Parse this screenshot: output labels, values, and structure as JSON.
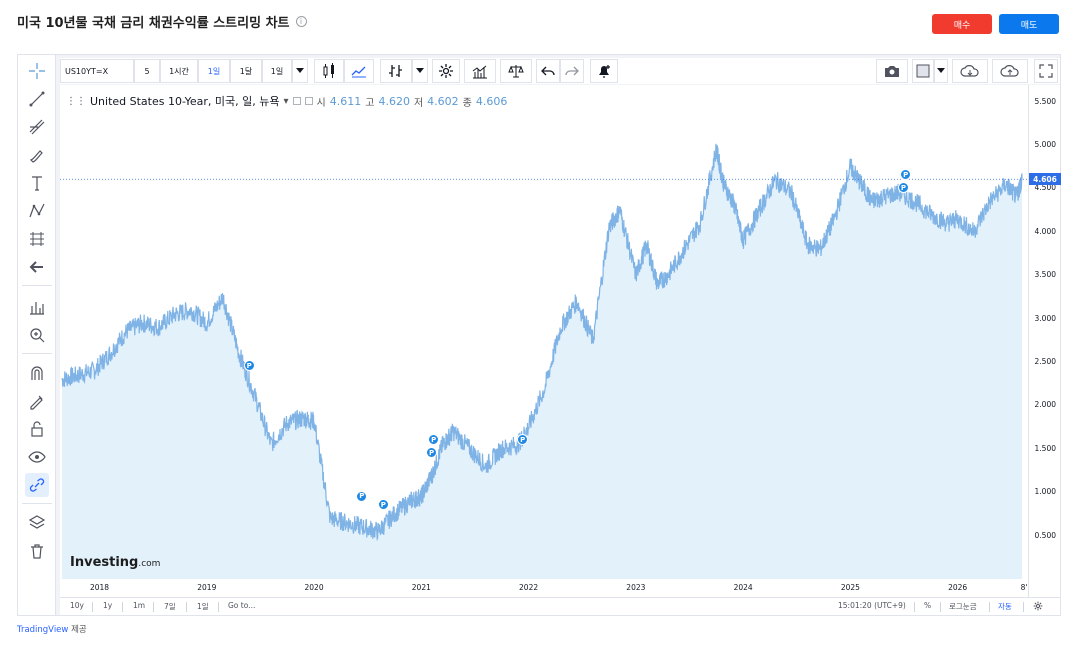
{
  "page": {
    "title": "미국 10년물 국채 금리 채권수익률 스트리밍 차트",
    "buy_label": "매수",
    "sell_label": "매도",
    "footer_link": "TradingView",
    "footer_text": "제공"
  },
  "toolbar": {
    "symbol": "US10YT=X",
    "intervals": [
      "5",
      "1시간",
      "1일",
      "1달",
      "1일"
    ],
    "active_interval_index": 2
  },
  "legend": {
    "name": "United States 10-Year, 미국, 일, 뉴욕",
    "open_label": "시",
    "open": "4.611",
    "high_label": "고",
    "high": "4.620",
    "low_label": "저",
    "low": "4.602",
    "close_label": "종",
    "close": "4.606"
  },
  "price_axis": {
    "labels": [
      "5.500",
      "5.000",
      "4.500",
      "4.000",
      "3.500",
      "3.000",
      "2.500",
      "2.000",
      "1.500",
      "1.000",
      "0.500"
    ],
    "current": "4.606"
  },
  "time_axis": {
    "labels": [
      "2018",
      "2019",
      "2020",
      "2021",
      "2022",
      "2023",
      "2024",
      "2025",
      "2026",
      "8'"
    ]
  },
  "bottom_bar": {
    "ranges": [
      "10y",
      "1y",
      "1m",
      "7일",
      "1일"
    ],
    "goto": "Go to...",
    "time": "15:01:20 (UTC+9)",
    "percent": "%",
    "log": "로그눈금",
    "auto": "자동"
  },
  "logo": {
    "main": "Investing",
    "suffix": ".com"
  },
  "markers": {
    "label": "P"
  },
  "chart_data": {
    "type": "area",
    "x": [
      2017.65,
      2017.8,
      2017.95,
      2018.1,
      2018.25,
      2018.4,
      2018.55,
      2018.7,
      2018.85,
      2019.0,
      2019.15,
      2019.3,
      2019.45,
      2019.6,
      2019.75,
      2019.9,
      2020.0,
      2020.15,
      2020.3,
      2020.45,
      2020.6,
      2020.75,
      2020.9,
      2021.0,
      2021.1,
      2021.2,
      2021.3,
      2021.45,
      2021.6,
      2021.75,
      2021.9,
      2022.0,
      2022.15,
      2022.3,
      2022.45,
      2022.6,
      2022.75,
      2022.85,
      2023.0,
      2023.1,
      2023.2,
      2023.3,
      2023.45,
      2023.6,
      2023.75,
      2023.82,
      2023.92,
      2024.0,
      2024.15,
      2024.3,
      2024.45,
      2024.6,
      2024.72,
      2024.85,
      2025.0,
      2025.1,
      2025.2,
      2025.3,
      2025.45,
      2025.6,
      2025.75,
      2025.9,
      2026.0,
      2026.15,
      2026.3,
      2026.45,
      2026.55,
      2026.6
    ],
    "y": [
      2.3,
      2.35,
      2.4,
      2.6,
      2.85,
      2.95,
      2.9,
      3.05,
      3.1,
      2.95,
      3.25,
      2.6,
      2.1,
      1.55,
      1.8,
      1.85,
      1.82,
      0.7,
      0.65,
      0.6,
      0.55,
      0.75,
      0.9,
      0.95,
      1.2,
      1.55,
      1.7,
      1.5,
      1.3,
      1.5,
      1.55,
      1.75,
      2.2,
      2.9,
      3.2,
      2.75,
      4.05,
      4.25,
      3.5,
      3.85,
      3.4,
      3.5,
      3.8,
      4.1,
      4.95,
      4.55,
      4.3,
      3.9,
      4.25,
      4.6,
      4.45,
      3.85,
      3.8,
      4.15,
      4.75,
      4.55,
      4.35,
      4.4,
      4.45,
      4.35,
      4.2,
      4.1,
      4.15,
      4.0,
      4.35,
      4.55,
      4.4,
      4.61
    ],
    "xlabels": [
      "2018",
      "2019",
      "2020",
      "2021",
      "2022",
      "2023",
      "2024",
      "2025",
      "2026",
      "8'"
    ],
    "ylim": [
      0.0,
      5.6
    ],
    "current_price": 4.606,
    "grid": false,
    "color": "#7fb3e6",
    "fill": "#e3f1fb",
    "markers_x": [
      2019.4,
      2020.45,
      2020.65,
      2021.1,
      2021.12,
      2021.95,
      2025.5,
      2025.52
    ],
    "markers_y": [
      2.45,
      0.95,
      0.85,
      1.45,
      1.6,
      1.6,
      4.5,
      4.65
    ]
  },
  "colors": {
    "accent": "#2962ff",
    "buy": "#f23b2f",
    "sell": "#0b78ee",
    "line": "#7fb3e6"
  }
}
